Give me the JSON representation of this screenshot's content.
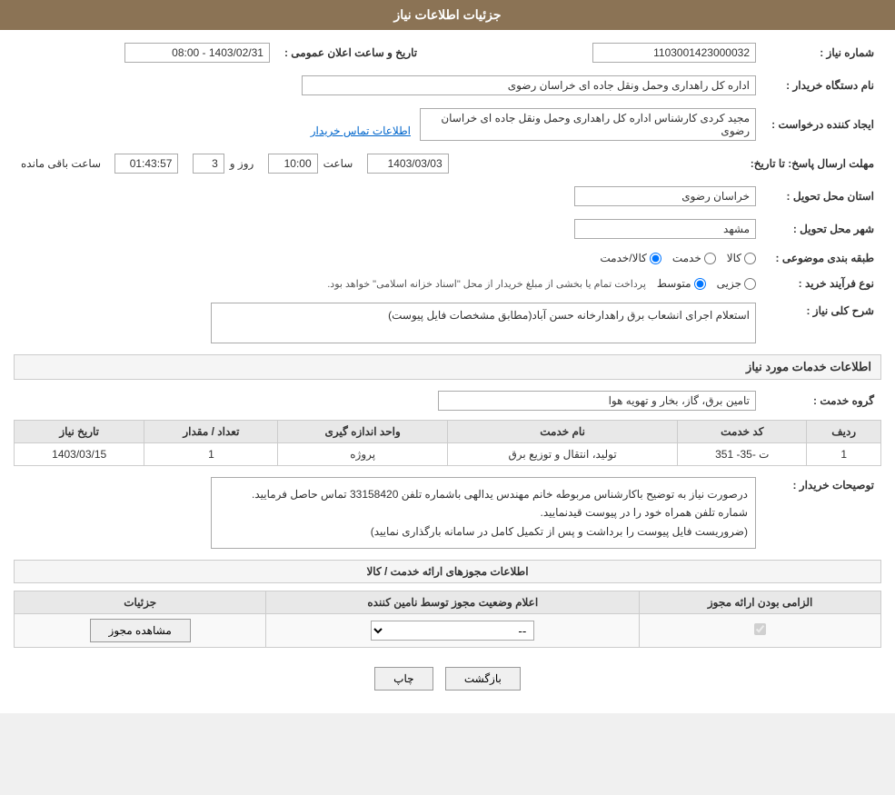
{
  "header": {
    "title": "جزئیات اطلاعات نیاز"
  },
  "fields": {
    "need_number_label": "شماره نیاز :",
    "need_number_value": "1103001423000032",
    "buyer_org_label": "نام دستگاه خریدار :",
    "buyer_org_value": "اداره کل راهداری وحمل ونقل جاده ای خراسان رضوی",
    "creator_label": "ایجاد کننده درخواست :",
    "creator_value": "مجید کردی کارشناس اداره کل راهداری وحمل ونقل جاده ای خراسان رضوی",
    "creator_link": "اطلاعات تماس خریدار",
    "deadline_label": "مهلت ارسال پاسخ: تا تاریخ:",
    "deadline_date": "1403/03/03",
    "deadline_time_label": "ساعت",
    "deadline_time": "10:00",
    "deadline_day_label": "روز و",
    "deadline_days": "3",
    "deadline_remaining_label": "ساعت باقی مانده",
    "deadline_remaining": "01:43:57",
    "announce_label": "تاریخ و ساعت اعلان عمومی :",
    "announce_value": "1403/02/31 - 08:00",
    "province_label": "استان محل تحویل :",
    "province_value": "خراسان رضوی",
    "city_label": "شهر محل تحویل :",
    "city_value": "مشهد",
    "category_label": "طبقه بندی موضوعی :",
    "category_options": [
      "کالا",
      "خدمت",
      "کالا/خدمت"
    ],
    "category_selected": "کالا",
    "purchase_type_label": "نوع فرآیند خرید :",
    "purchase_type_options": [
      "جزیی",
      "متوسط"
    ],
    "purchase_type_note": "پرداخت تمام یا بخشی از مبلغ خریدار از محل \"اسناد خزانه اسلامی\" خواهد بود.",
    "description_label": "شرح کلی نیاز :",
    "description_value": "استعلام اجرای انشعاب برق راهدارخانه حسن آباد(مطابق مشخصات فایل پیوست)",
    "services_section": "اطلاعات خدمات مورد نیاز",
    "service_group_label": "گروه خدمت :",
    "service_group_value": "تامین برق، گاز، بخار و تهویه هوا",
    "services_table": {
      "headers": [
        "ردیف",
        "کد خدمت",
        "نام خدمت",
        "واحد اندازه گیری",
        "تعداد / مقدار",
        "تاریخ نیاز"
      ],
      "rows": [
        {
          "row": "1",
          "code": "ت -35- 351",
          "name": "تولید، انتقال و توزیع برق",
          "unit": "پروژه",
          "quantity": "1",
          "date": "1403/03/15"
        }
      ]
    },
    "buyer_notes_label": "توصیحات خریدار :",
    "buyer_notes_line1": "درصورت نیاز به توضیح باکارشناس مربوطه خانم مهندس یدالهی باشماره تلفن 33158420 تماس حاصل فرمایید.",
    "buyer_notes_line2": "شماره تلفن همراه خود را در پیوست قیدنمایید.",
    "buyer_notes_line3": "(ضروریست فایل پیوست را برداشت و پس از تکمیل کامل در سامانه بارگذاری نمایید)",
    "permissions_section": "اطلاعات مجوزهای ارائه خدمت / کالا",
    "permissions_table": {
      "headers": [
        "الزامی بودن ارائه مجوز",
        "اعلام وضعیت مجوز توسط نامین کننده",
        "جزئیات"
      ],
      "rows": [
        {
          "required": true,
          "status": "--",
          "detail": "مشاهده مجوز"
        }
      ]
    },
    "print_button": "چاپ",
    "back_button": "بازگشت"
  }
}
